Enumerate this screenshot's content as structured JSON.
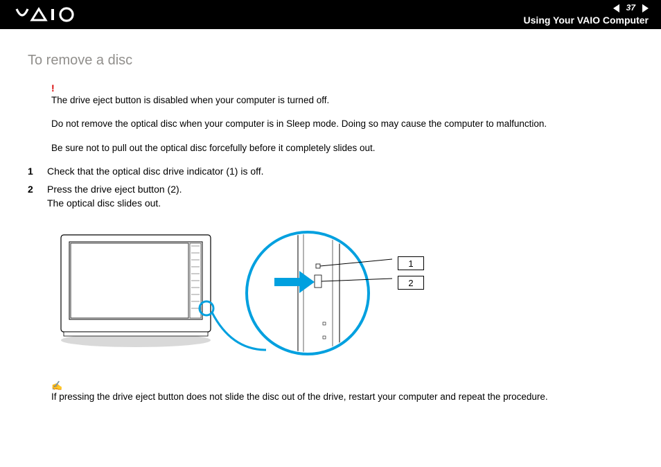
{
  "header": {
    "page_number": "37",
    "section": "Using Your VAIO Computer",
    "logo_alt": "VAIO"
  },
  "title": "To remove a disc",
  "important_marker": "!",
  "important_lines": [
    "The drive eject button is disabled when your computer is turned off.",
    "Do not remove the optical disc when your computer is in Sleep mode. Doing so may cause the computer to malfunction.",
    "Be sure not to pull out the optical disc forcefully before it completely slides out."
  ],
  "steps": [
    {
      "n": "1",
      "text": "Check that the optical disc drive indicator (1) is off."
    },
    {
      "n": "2",
      "text": "Press the drive eject button (2).\nThe optical disc slides out."
    }
  ],
  "callouts": {
    "c1": "1",
    "c2": "2"
  },
  "note_icon": "✍",
  "note_text": "If pressing the drive eject button does not slide the disc out of the drive, restart your computer and repeat the procedure."
}
